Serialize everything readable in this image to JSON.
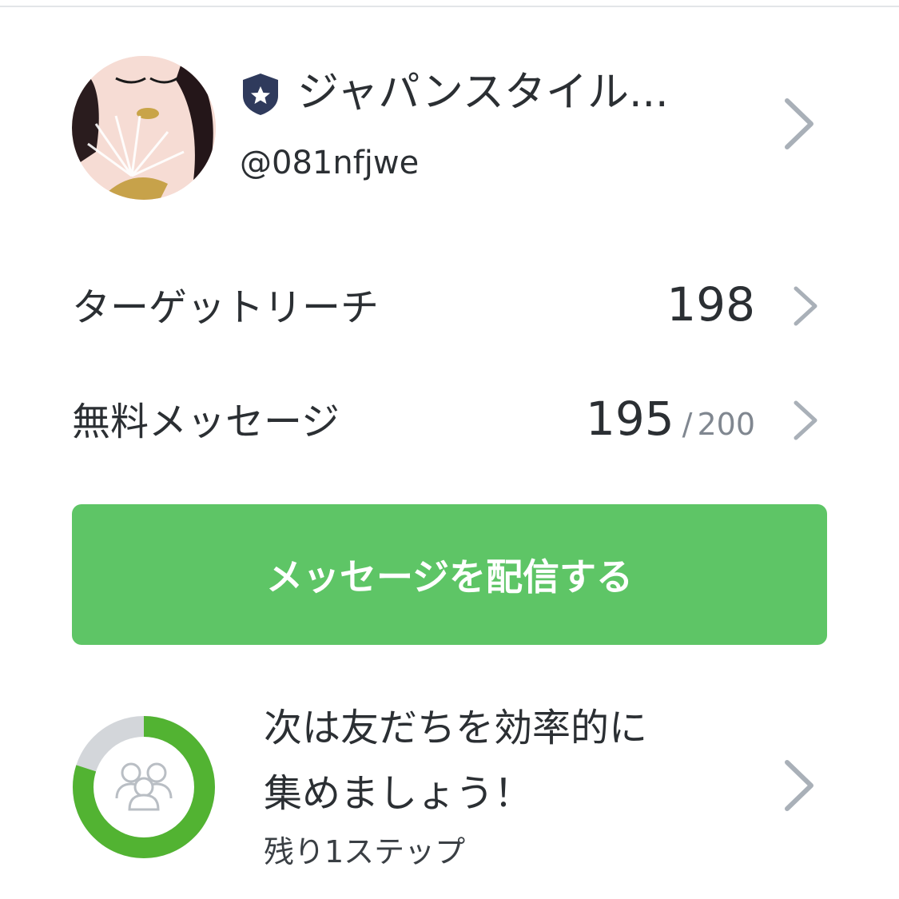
{
  "profile": {
    "account_name": "ジャパンスタイル...",
    "account_id": "@081nfjwe",
    "badge_icon": "shield-star-icon",
    "badge_color": "#2f3a5c"
  },
  "stats": {
    "target_reach": {
      "label": "ターゲットリーチ",
      "value": "198"
    },
    "free_messages": {
      "label": "無料メッセージ",
      "used": "195",
      "separator": "/",
      "total": "200"
    }
  },
  "cta": {
    "label": "メッセージを配信する",
    "color": "#5ec566"
  },
  "next_step": {
    "title_line1": "次は友だちを効率的に",
    "title_line2": "集めましょう！",
    "subtitle": "残り1ステップ",
    "progress_fraction": 0.8,
    "progress_color": "#52b332",
    "track_color": "#d3d6da",
    "icon": "friends-icon"
  }
}
